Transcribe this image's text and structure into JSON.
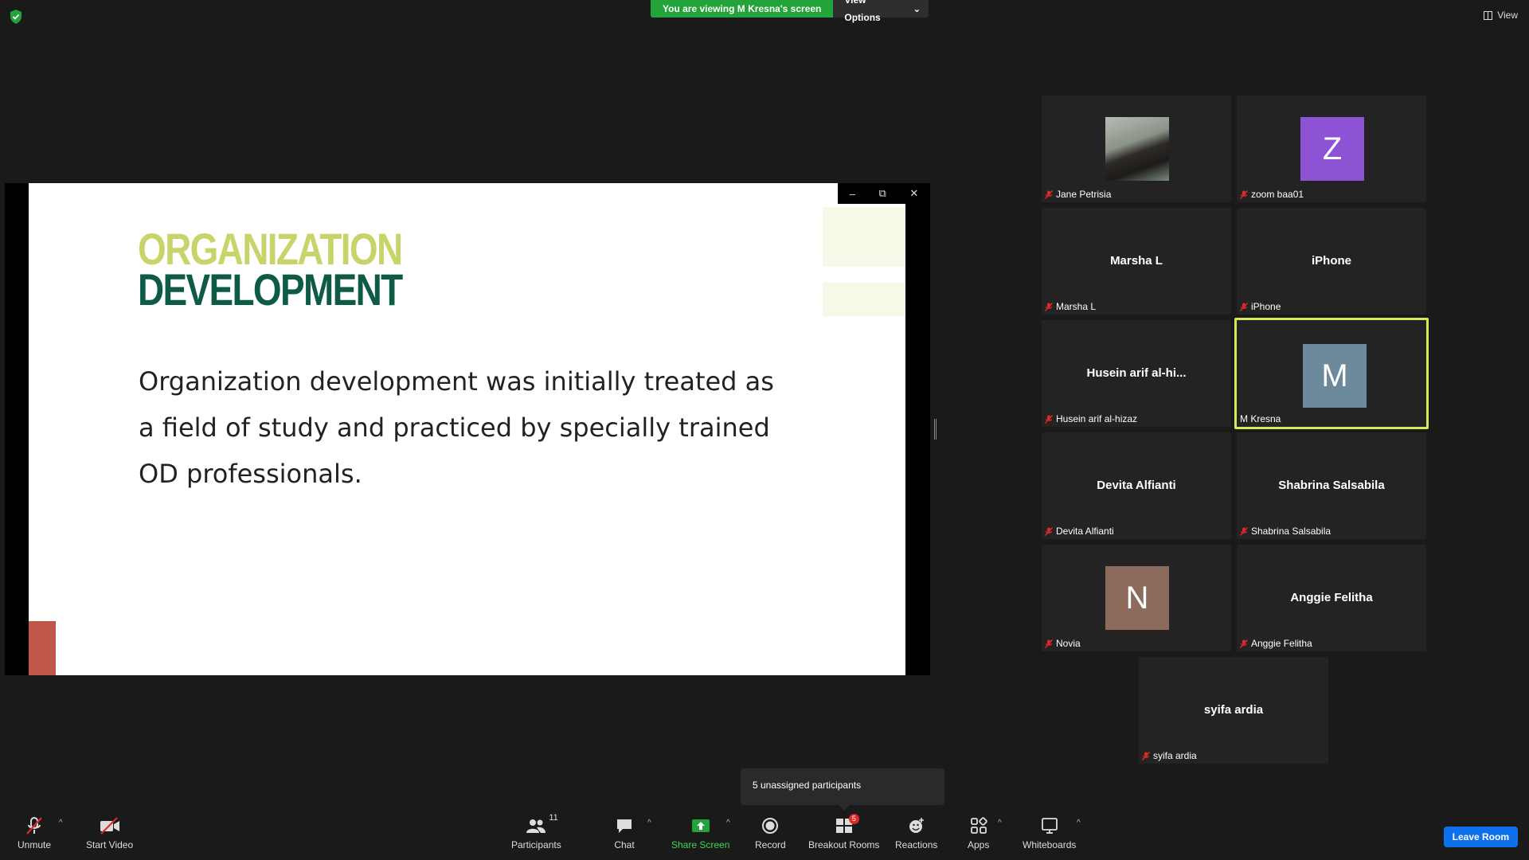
{
  "banner": {
    "viewing_text": "You are viewing M Kresna's screen",
    "view_options_label": "View Options"
  },
  "top_right": {
    "view_label": "View"
  },
  "slide": {
    "title_line1": "ORGANIZATION",
    "title_line2": "DEVELOPMENT",
    "body_line1": "Organization development was initially treated as",
    "body_line2": "a field of study and practiced by specially trained",
    "body_line3": "OD professionals."
  },
  "participants": [
    {
      "name": "Jane Petrisia",
      "center": "",
      "avatar_letter": "",
      "avatar_color": ""
    },
    {
      "name": "zoom baa01",
      "center": "",
      "avatar_letter": "Z",
      "avatar_color": "#8e52d5"
    },
    {
      "name": "Marsha L",
      "center": "Marsha L",
      "avatar_letter": "",
      "avatar_color": ""
    },
    {
      "name": "iPhone",
      "center": "iPhone",
      "avatar_letter": "",
      "avatar_color": ""
    },
    {
      "name": "Husein arif al-hizaz",
      "center": "Husein arif al-hi...",
      "avatar_letter": "",
      "avatar_color": ""
    },
    {
      "name": "M Kresna",
      "center": "",
      "avatar_letter": "M",
      "avatar_color": "#6d8a9c"
    },
    {
      "name": "Devita Alfianti",
      "center": "Devita Alfianti",
      "avatar_letter": "",
      "avatar_color": ""
    },
    {
      "name": "Shabrina Salsabila",
      "center": "Shabrina Salsabila",
      "avatar_letter": "",
      "avatar_color": ""
    },
    {
      "name": "Novia",
      "center": "",
      "avatar_letter": "N",
      "avatar_color": "#8c6a5c"
    },
    {
      "name": "Anggie Felitha",
      "center": "Anggie Felitha",
      "avatar_letter": "",
      "avatar_color": ""
    },
    {
      "name": "syifa ardia",
      "center": "syifa ardia",
      "avatar_letter": "",
      "avatar_color": ""
    }
  ],
  "tooltip": {
    "text": "5 unassigned participants"
  },
  "toolbar": {
    "unmute": "Unmute",
    "start_video": "Start Video",
    "participants": "Participants",
    "participants_count": "11",
    "chat": "Chat",
    "share_screen": "Share Screen",
    "record": "Record",
    "breakout_rooms": "Breakout Rooms",
    "breakout_badge": "5",
    "reactions": "Reactions",
    "apps": "Apps",
    "whiteboards": "Whiteboards",
    "leave": "Leave Room"
  },
  "colors": {
    "green": "#23a43a",
    "active_border": "#d7e85a",
    "leave_blue": "#0e71eb",
    "muted_red": "#e02828"
  }
}
